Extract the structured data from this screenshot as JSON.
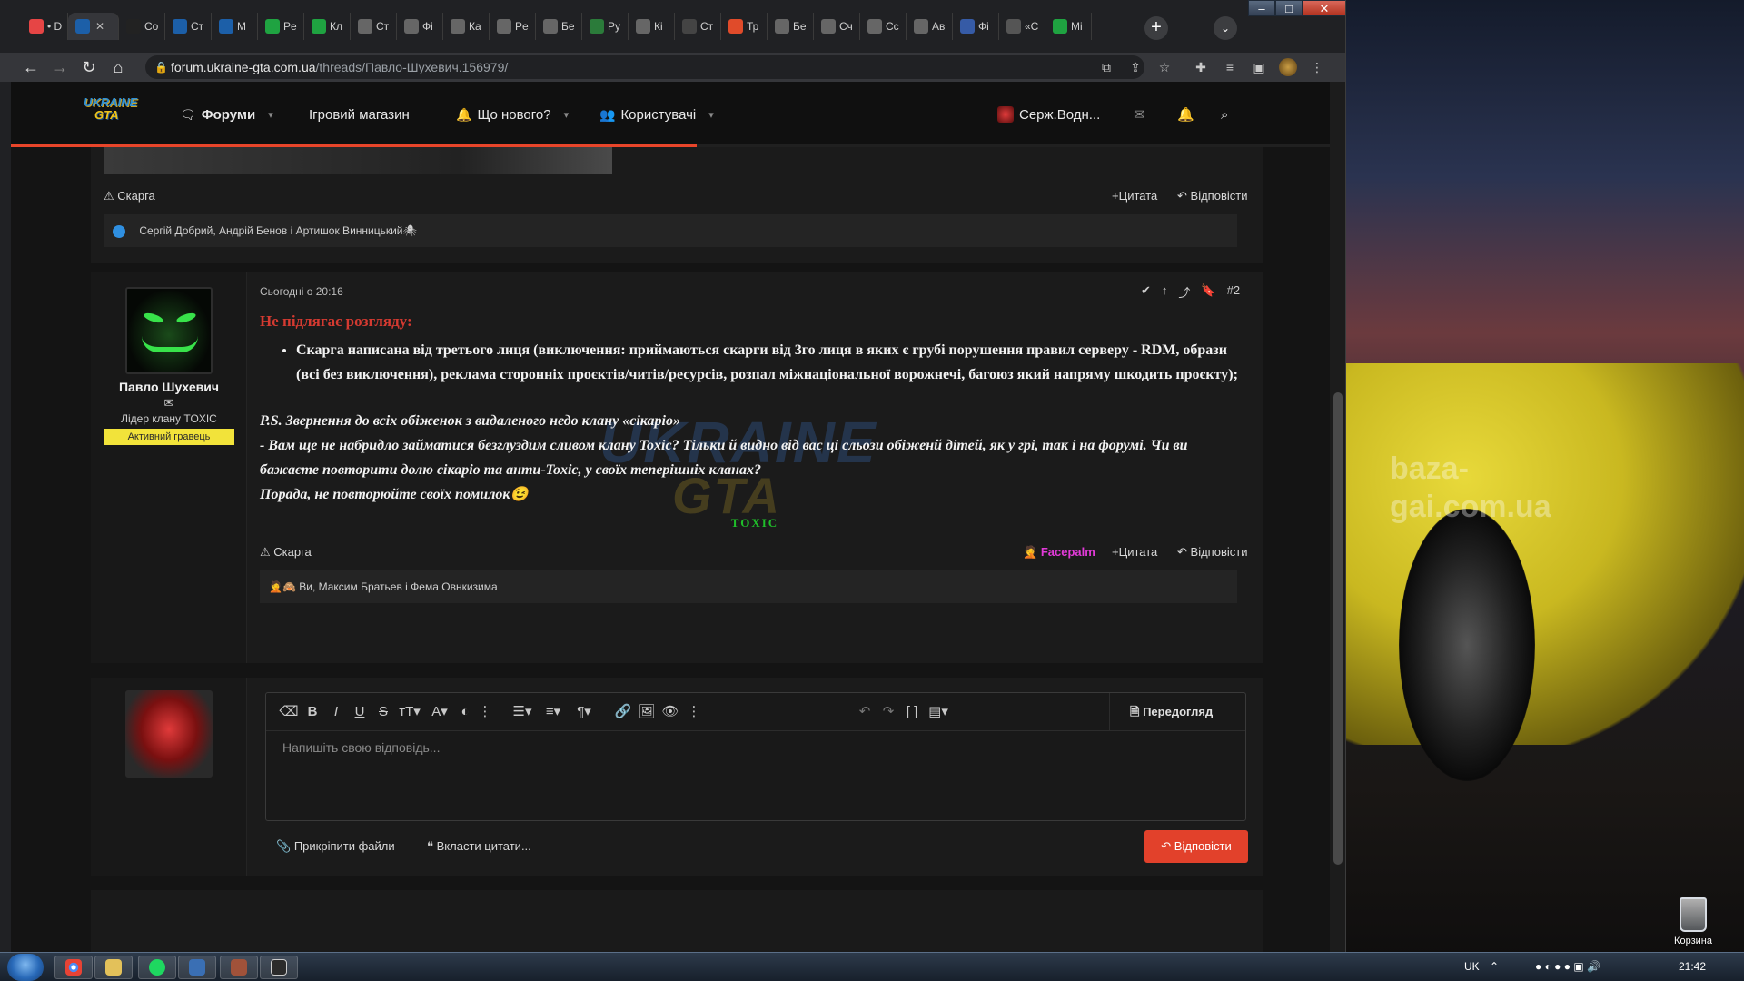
{
  "browser": {
    "tabs": [
      {
        "label": "• D",
        "fav": "#e64545"
      },
      {
        "label": "",
        "fav": "#1c5fa8"
      },
      {
        "label": "Co",
        "fav": "#222"
      },
      {
        "label": "Ст",
        "fav": "#1c5fa8"
      },
      {
        "label": "M",
        "fav": "#1c5fa8"
      },
      {
        "label": "Pe",
        "fav": "#1fa341"
      },
      {
        "label": "Кл",
        "fav": "#1fa341"
      },
      {
        "label": "Ст",
        "fav": "#666"
      },
      {
        "label": "Фі",
        "fav": "#666"
      },
      {
        "label": "Ка",
        "fav": "#666"
      },
      {
        "label": "Pe",
        "fav": "#666"
      },
      {
        "label": "Бе",
        "fav": "#666"
      },
      {
        "label": "Ру",
        "fav": "#2b7b3a"
      },
      {
        "label": "Кі",
        "fav": "#666"
      },
      {
        "label": "Ст",
        "fav": "#444"
      },
      {
        "label": "Тр",
        "fav": "#e04b2a"
      },
      {
        "label": "Бе",
        "fav": "#666"
      },
      {
        "label": "Сч",
        "fav": "#666"
      },
      {
        "label": "Сс",
        "fav": "#666"
      },
      {
        "label": "Ав",
        "fav": "#666"
      },
      {
        "label": "Фі",
        "fav": "#365ba6"
      },
      {
        "label": "«С",
        "fav": "#555"
      },
      {
        "label": "Mi",
        "fav": "#1fa341"
      }
    ],
    "url_host": "forum.ukraine-gta.com.ua",
    "url_path": "/threads/Павло-Шухевич.156979/"
  },
  "forum": {
    "logo_top": "UKRAINE",
    "logo_bottom": "GTA",
    "nav": {
      "forums": "Форуми",
      "shop": "Ігровий магазин",
      "whats_new": "Що нового?",
      "users": "Користувачі",
      "account": "Серж.Водн..."
    },
    "scroll_progress": 0.52
  },
  "prev_post": {
    "report": "Скарга",
    "quote": "+Цитата",
    "reply": "Відповісти",
    "reactions": "Сергій Добрий, Андрій Бенов і Артишок Винницький🕷"
  },
  "post2": {
    "author": "Павло Шухевич",
    "title": "Лідер клану TOXIC",
    "banner": "Активний гравець",
    "time": "Сьогодні о 20:16",
    "number": "#2",
    "heading": "Не підлягає розгляду:",
    "bullet": "Скарга написана від третього лиця (виключення: приймаються скарги від 3го лиця в яких є грубі порушення правил серверу - RDM, образи (всі без виключення), реклама сторонніх проєктів/читів/ресурсів, розпал міжнаціональної ворожнечі, багоюз який напряму шкодить проєкту);",
    "ps_line1": "P.S. Звернення до всіх обіженок з видаленого недо клану «сікаріо»",
    "ps_line2": "- Вам ще не набридло займатися безглуздим сливом клану Toxic? Тільки й видно від вас ці сльози обіженй дітей, як у грі, так і на форумі. Чи ви бажаєте повторити долю сікаріо та анти-Toxic, у своїх теперішніх кланах?",
    "ps_line3": "Порада, не повторюйте своїх помилок😉",
    "signature": "TOXIC",
    "report": "Скарга",
    "facepalm": "Facepalm",
    "quote": "+Цитата",
    "reply": "Відповісти",
    "reactions": "Ви, Максим Братьев і Фема Овнкизима",
    "watermark_top": "UKRAINE",
    "watermark_bottom": "GTA"
  },
  "reply_box": {
    "placeholder": "Напишіть свою відповідь...",
    "preview": "Передогляд",
    "attach": "Прикріпити файли",
    "insert_quotes": "Вкласти цитати...",
    "submit": "Відповісти"
  },
  "desktop": {
    "watermark_line1": "baza-",
    "watermark_line2": "gai.com.ua",
    "recycle_bin": "Корзина"
  },
  "taskbar": {
    "lang": "UK",
    "clock": "21:42"
  },
  "colors": {
    "accent": "#e2412b",
    "warn": "#d43a31",
    "signature": "#1fbf2a",
    "facepalm": "#e23ad8",
    "banner": "#f2e33a"
  }
}
